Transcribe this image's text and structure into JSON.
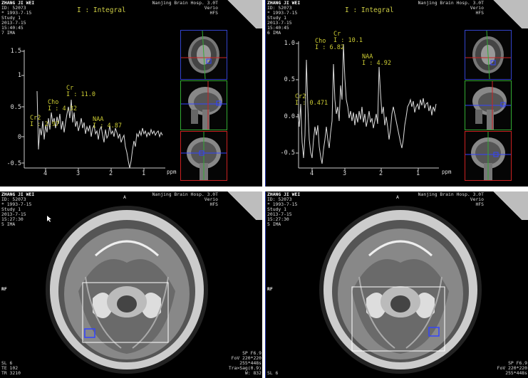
{
  "panels": [
    {
      "patient": "ZHANG JI WEI",
      "id": "ID: 52073",
      "dob": "* 1993-7-15",
      "study": "Study 1",
      "date": "2013-7-15",
      "time": "15:40:45",
      "ima": "7 IMA",
      "hospital": "Nanjing Brain Hosp. 3.0T",
      "scanner": "Verio",
      "position": "HFS",
      "mode": "I : Integral",
      "y_ticks": [
        "1.5",
        "1",
        "0.5",
        "0",
        "-0.5"
      ],
      "x_ticks": [
        "4",
        "3",
        "2",
        "1"
      ],
      "x_unit": "ppm",
      "peaks": [
        {
          "name": "Cr2",
          "value": "I : 2.97"
        },
        {
          "name": "Cho",
          "value": "I : 4.32"
        },
        {
          "name": "Cr",
          "value": "I : 11.0"
        },
        {
          "name": "NAA",
          "value": "I : 4.87"
        }
      ]
    },
    {
      "patient": "ZHANG JI WEI",
      "id": "ID: 52073",
      "dob": "* 1993-7-15",
      "study": "Study 1",
      "date": "2013-7-15",
      "time": "15:40:45",
      "ima": "6 IMA",
      "hospital": "Nanjing Brain Hosp. 3.0T",
      "scanner": "Verio",
      "position": "HFS",
      "mode": "I : Integral",
      "y_ticks": [
        "1.0",
        "0.5",
        "0.0",
        "-0.5"
      ],
      "x_ticks": [
        "4",
        "3",
        "2",
        "1"
      ],
      "x_unit": "ppm",
      "peaks": [
        {
          "name": "Cho",
          "value": "I : 6.82"
        },
        {
          "name": "Cr",
          "value": "I : 10.1"
        },
        {
          "name": "NAA",
          "value": "I : 4.92"
        },
        {
          "name": "Cr2",
          "value": "I : 0.471"
        }
      ]
    },
    {
      "patient": "ZHANG JI WEI",
      "id": "ID: 52073",
      "dob": "* 1993-7-15",
      "study": "Study 1",
      "date": "2013-7-15",
      "time": "15:27:30",
      "ima": "5 IMA",
      "hospital": "Nanjing Brain Hosp. 3.0T",
      "scanner": "Verio",
      "position": "HFS",
      "orient_top": "A",
      "orient_left": "RF",
      "bottom_left": [
        "SL 6",
        "TE 102",
        "TR 3210"
      ],
      "bottom_right": [
        "SP F6.9",
        "FoV 220*220",
        "255*448s",
        "Tra>Sag(0.9)",
        "W: 832"
      ]
    },
    {
      "patient": "ZHANG JI WEI",
      "id": "ID: 52073",
      "dob": "* 1993-7-15",
      "study": "Study 1",
      "date": "2013-7-15",
      "time": "15:27:30",
      "ima": "5 IMA",
      "hospital": "Nanjing Brain Hosp. 3.0T",
      "scanner": "Verio",
      "position": "HFS",
      "orient_top": "A",
      "orient_left": "RF",
      "bottom_left": [
        "SL 6"
      ],
      "bottom_right": [
        "SP F6.9",
        "FoV 220*220",
        "255*448s"
      ]
    }
  ],
  "colors": {
    "peak_label": "#cccc33",
    "voxel_box": "#3344ff",
    "cursor_red": "#cc2222",
    "cursor_green": "#33aa33"
  }
}
